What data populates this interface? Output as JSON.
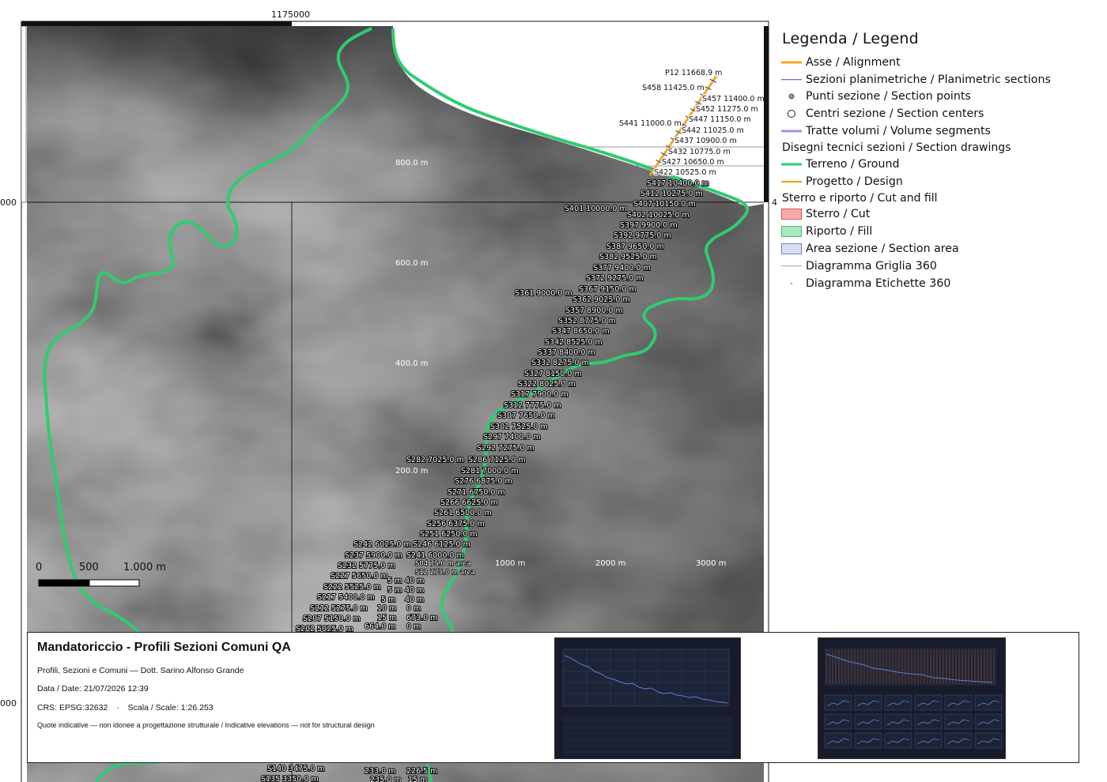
{
  "map": {
    "frame_coords": {
      "top_easting": "1175000",
      "left_northing_upper": "000",
      "left_northing_lower": "000",
      "right_northing_marker": "4"
    },
    "contour_labels": [
      "800.0 m",
      "600.0 m",
      "400.0 m",
      "200.0 m"
    ],
    "distance_labels": [
      "1000 m",
      "2000 m",
      "3000 m"
    ],
    "scale_bar": {
      "labels": [
        "0",
        "500",
        "1.000 m"
      ]
    },
    "section_labels": [
      "P12 11668.9 m",
      "S458 11425.0 m",
      "S457 11400.0 m",
      "S452 11275.0 m",
      "S447 11150.0 m",
      "S441 11000.0 m",
      "S442 11025.0 m",
      "S437 10900.0 m",
      "S432 10775.0 m",
      "S427 10650.0 m",
      "S422 10525.0 m",
      "S417 10400.0 m",
      "S412 10275.0 m",
      "S407 10150.0 m",
      "S401 10000.0 m",
      "S402 10025.0 m",
      "S397 9900.0 m",
      "S392 9775.0 m",
      "S387 9650.0 m",
      "S382 9525.0 m",
      "S377 9400.0 m",
      "S372 9275.0 m",
      "S367 9150.0 m",
      "S361 9000.0 m",
      "S362 9025.0 m",
      "S357 8900.0 m",
      "S352 8775.0 m",
      "S347 8650.0 m",
      "S342 8525.0 m",
      "S337 8400.0 m",
      "S332 8275.0 m",
      "S327 8150.0 m",
      "S322 8025.0 m",
      "S317 7900.0 m",
      "S312 7775.0 m",
      "S307 7650.0 m",
      "S302 7525.0 m",
      "S297 7400.0 m",
      "S292 7275.0 m",
      "S282 7025.0 m",
      "S286 7125.0 m",
      "S281 7000.0 m",
      "S276 6875.0 m",
      "S271 6750.0 m",
      "S266 6625.0 m",
      "S261 6500.0 m",
      "S256 6375.0 m",
      "S251 6250.0 m",
      "S242 6025.0 m",
      "S246 6125.0 m",
      "S237 5900.0 m",
      "S241 6000.0 m",
      "S232 5775.0 m",
      "S227 5650.0 m",
      "S222 5525.0 m",
      "S217 5400.0 m",
      "S212 5275.0 m",
      "S207 5150.0 m",
      "S202 5025.0 m",
      "S140 3475.0 m",
      "S135 3350.0 m"
    ],
    "area_labels": [
      "S04 75.0 m area",
      "S12 275.0 m area"
    ],
    "misc_labels": [
      "5 m",
      "40 m",
      "5 m",
      "40 m",
      "5 m",
      "40 m",
      "10 m",
      "0 m",
      "15 m",
      "673.0 m",
      "664.0 m",
      "0 m",
      "233.0 m",
      "226.5 m",
      "235.0 m",
      "15 m"
    ]
  },
  "legend": {
    "title": "Legenda / Legend",
    "items_top": [
      {
        "label": "Asse / Alignment",
        "kind": "line",
        "color": "#f5a623",
        "width": 3
      },
      {
        "label": "Sezioni planimetriche / Planimetric sections",
        "kind": "line",
        "color": "#3d5a9e",
        "width": 1.5
      },
      {
        "label": "Punti sezione / Section points",
        "kind": "dot",
        "color": "#555555"
      },
      {
        "label": "Centri sezione / Section centers",
        "kind": "circle",
        "color": "#222222"
      },
      {
        "label": "Tratte volumi / Volume segments",
        "kind": "line",
        "color": "#a98ee8",
        "width": 3
      }
    ],
    "group_drawings": "Disegni tecnici sezioni / Section drawings",
    "items_drawings": [
      {
        "label": "Terreno / Ground",
        "kind": "line",
        "color": "#2ecc71",
        "width": 3
      },
      {
        "label": "Progetto / Design",
        "kind": "line",
        "color": "#f39c12",
        "width": 2
      }
    ],
    "group_cutfill": "Sterro e riporto / Cut and fill",
    "items_cutfill": [
      {
        "label": "Sterro / Cut",
        "kind": "box",
        "color": "#f4aaaa",
        "border": "#d65a5a"
      },
      {
        "label": "Riporto / Fill",
        "kind": "box",
        "color": "#a8e6bd",
        "border": "#4cbb74"
      },
      {
        "label": "Area sezione / Section area",
        "kind": "box",
        "color": "#d6def3",
        "border": "#6f83b8"
      },
      {
        "label": "Diagramma Griglia 360",
        "kind": "line",
        "color": "#9a9a9a",
        "width": 1.5
      },
      {
        "label": "Diagramma Etichette 360",
        "kind": "tiny",
        "color": "#777777"
      }
    ]
  },
  "infobox": {
    "title": "Mandatoriccio - Profili Sezioni Comuni QA",
    "subtitle": "Profili, Sezioni e Comuni — Dott. Sarino Alfonso Grande",
    "date": "Data / Date: 21/07/2026 12:39",
    "crs": "CRS: EPSG:32632",
    "separator": "·",
    "scale": "Scala / Scale: 1:26.253",
    "disclaimer": "Quote indicative — non idonee a progettazione strutturale / Indicative elevations — not for structural design"
  },
  "colors": {
    "ground_line": "#2ecc71",
    "alignment": "#f5a623",
    "sea": "#ffffff",
    "dem_dark": "#0b0b0b",
    "dem_light": "#7a7a7a",
    "thumb_bg": "#171b2b",
    "thumb_profile": "#5b7fd6",
    "thumb_grid_orange": "#d2692a"
  }
}
